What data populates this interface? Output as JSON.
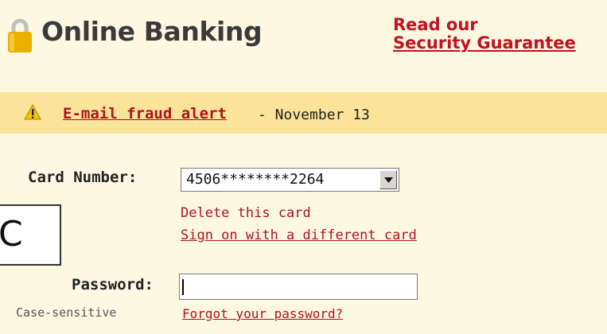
{
  "header": {
    "title": "Online Banking",
    "security_line1": "Read our",
    "security_line2": "Security Guarantee",
    "lock_icon": "lock-icon"
  },
  "alert": {
    "icon": "warning-icon",
    "link_text": "E-mail fraud alert",
    "date_text": "- November 13"
  },
  "form": {
    "card_label": "Card Number:",
    "card_value": "4506********2264",
    "delete_card": "Delete this card",
    "different_card": "Sign on with a different card",
    "password_label": "Password:",
    "password_value": "",
    "case_note": "Case-sensitive",
    "forgot_password": "Forgot your password?"
  },
  "overlay": {
    "letter": "C"
  },
  "colors": {
    "background": "#fdf8e2",
    "alert_bg": "#f9e49a",
    "link_red": "#b1121d",
    "lock_gold": "#e9b000"
  }
}
